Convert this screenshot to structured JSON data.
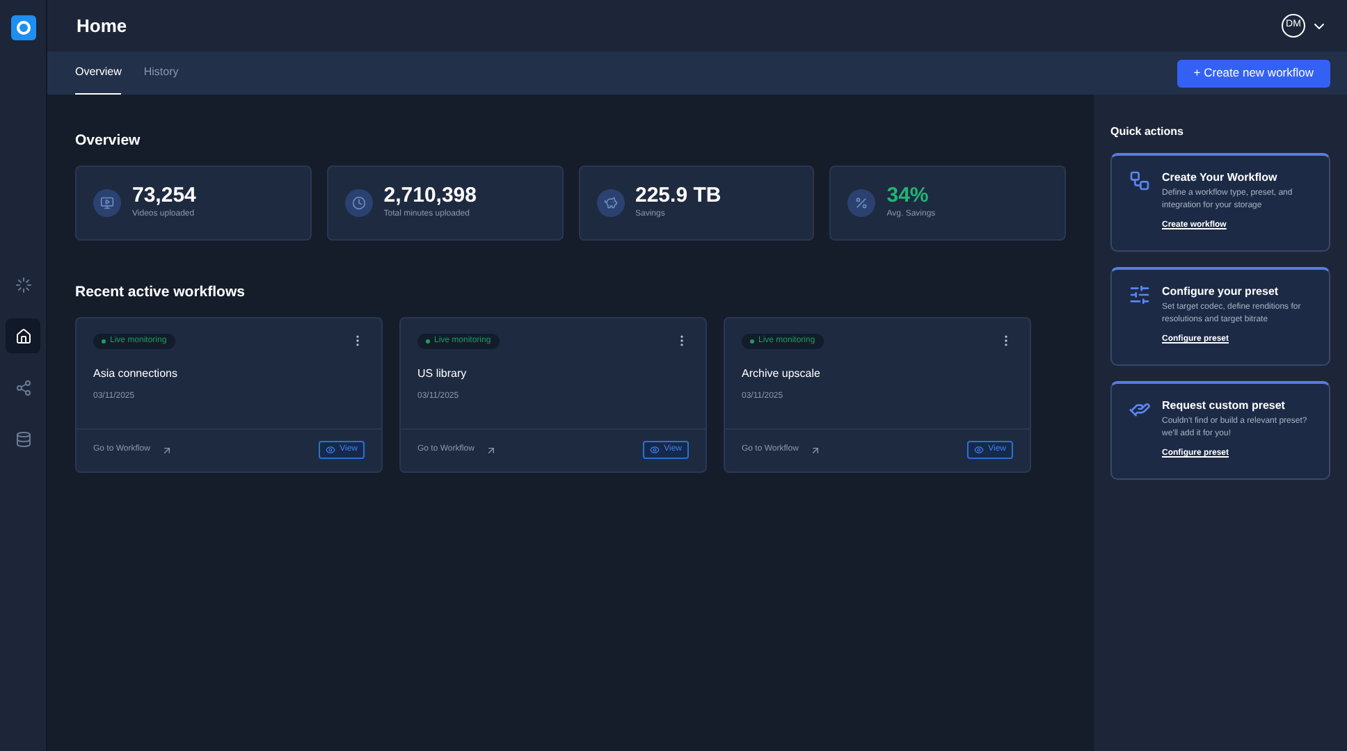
{
  "header": {
    "title": "Home",
    "avatar": "DM"
  },
  "sidebar": {
    "items": [
      {
        "kind": "loader",
        "selected": false
      },
      {
        "kind": "home",
        "selected": true
      },
      {
        "kind": "share",
        "selected": false
      },
      {
        "kind": "database",
        "selected": false
      }
    ]
  },
  "tabs": [
    {
      "label": "Overview",
      "selected": true
    },
    {
      "label": "History",
      "selected": false
    }
  ],
  "create_button": "+ Create new workflow",
  "overview": {
    "title": "Overview",
    "stats": [
      {
        "kind": "videos",
        "value": "73,254",
        "label": "Videos uploaded",
        "highlight": false
      },
      {
        "kind": "minutes",
        "value": "2,710,398",
        "label": "Total minutes uploaded",
        "highlight": false
      },
      {
        "kind": "savings",
        "value": "225.9 TB",
        "label": "Savings",
        "highlight": false
      },
      {
        "kind": "percent",
        "value": "34%",
        "label": "Avg. Savings",
        "highlight": true
      }
    ]
  },
  "recent": {
    "title": "Recent active workflows",
    "workflows": [
      {
        "status": "Live monitoring",
        "name": "Asia connections",
        "date": "03/11/2025",
        "link": "Go to Workflow",
        "button": "View"
      },
      {
        "status": "Live monitoring",
        "name": "US library",
        "date": "03/11/2025",
        "link": "Go to Workflow",
        "button": "View"
      },
      {
        "status": "Live monitoring",
        "name": "Archive upscale",
        "date": "03/11/2025",
        "link": "Go to Workflow",
        "button": "View"
      }
    ]
  },
  "quick_actions": {
    "title": "Quick actions",
    "items": [
      {
        "kind": "workflow",
        "title": "Create Your Workflow",
        "description": "Define a workflow type, preset, and integration for your storage",
        "link": "Create workflow"
      },
      {
        "kind": "preset",
        "title": "Configure your preset",
        "description": "Set target codec, define renditions for resolutions and target bitrate",
        "link": "Configure preset"
      },
      {
        "kind": "request",
        "title": "Request custom preset",
        "description": "Couldn't find or build a relevant preset? we'll add it for you!",
        "link": "Configure preset"
      }
    ]
  }
}
